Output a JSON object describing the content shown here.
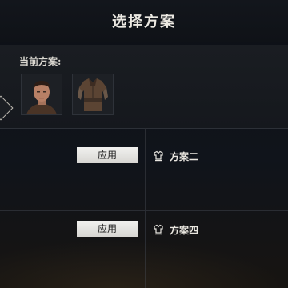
{
  "header": {
    "title": "选择方案"
  },
  "current": {
    "label": "当前方案:",
    "slots": [
      {
        "icon": "character-face-icon"
      },
      {
        "icon": "leather-armor-icon"
      }
    ]
  },
  "plans": [
    {
      "apply_label": "应用",
      "icon": "armor-stand-icon",
      "name": "方案二"
    },
    {
      "apply_label": "应用",
      "icon": "armor-stand-icon",
      "name": "方案四"
    }
  ]
}
